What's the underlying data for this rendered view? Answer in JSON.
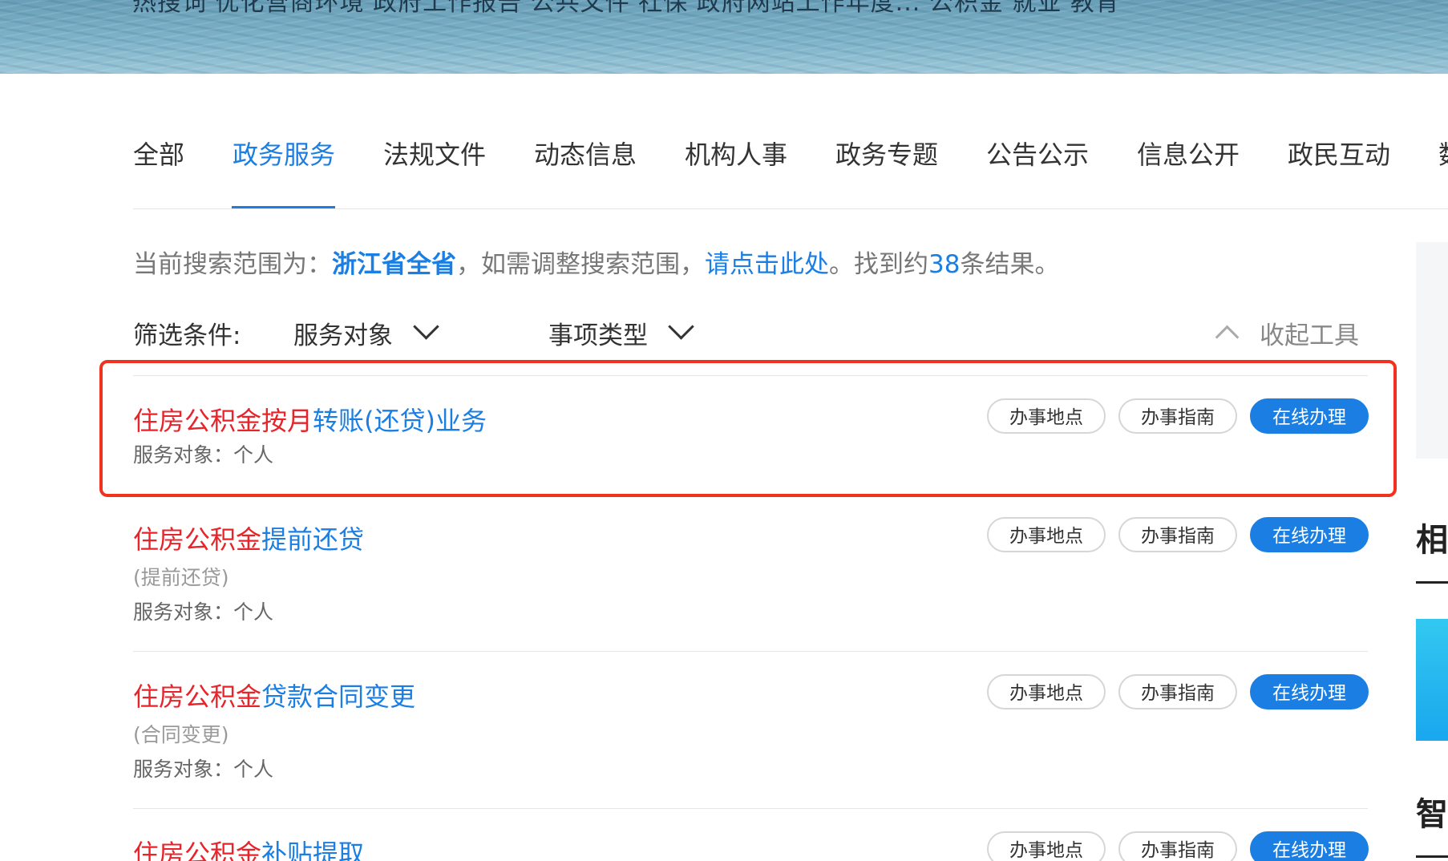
{
  "banner": {
    "text": "热搜词  优化营商环境  政府工作报告  公共文件  社保  政府网站工作年度...  公积金  就业  教育"
  },
  "tabs": [
    {
      "label": "全部",
      "active": false
    },
    {
      "label": "政务服务",
      "active": true
    },
    {
      "label": "法规文件",
      "active": false
    },
    {
      "label": "动态信息",
      "active": false
    },
    {
      "label": "机构人事",
      "active": false
    },
    {
      "label": "政务专题",
      "active": false
    },
    {
      "label": "公告公示",
      "active": false
    },
    {
      "label": "信息公开",
      "active": false
    },
    {
      "label": "政民互动",
      "active": false
    },
    {
      "label": "数",
      "active": false
    }
  ],
  "scope": {
    "prefix": "当前搜索范围为：",
    "region": "浙江省全省",
    "middle": "，如需调整搜索范围，",
    "link": "请点击此处",
    "found_prefix": "。找到约",
    "count": "38",
    "found_suffix": "条结果。"
  },
  "filters": {
    "label": "筛选条件:",
    "service_target": "服务对象",
    "item_type": "事项类型",
    "collapse": "收起工具"
  },
  "buttons": {
    "location": "办事地点",
    "guide": "办事指南",
    "online": "在线办理"
  },
  "results": [
    {
      "title_hl": "住房公积金按月",
      "title_rest": "转账(还贷)业务",
      "sub": "",
      "meta": "服务对象：个人"
    },
    {
      "title_hl": "住房公积金",
      "title_rest": "提前还贷",
      "sub": "(提前还贷)",
      "meta": "服务对象：个人"
    },
    {
      "title_hl": "住房公积金",
      "title_rest": "贷款合同变更",
      "sub": "(合同变更)",
      "meta": "服务对象：个人"
    },
    {
      "title_hl": "住房公积金",
      "title_rest": "补贴提取",
      "sub": "",
      "meta": ""
    }
  ],
  "side": {
    "char1": "相",
    "char2": "智"
  },
  "colors": {
    "accent": "#1a7ee3",
    "highlight": "#e8232a",
    "annotation": "#f0321e"
  }
}
